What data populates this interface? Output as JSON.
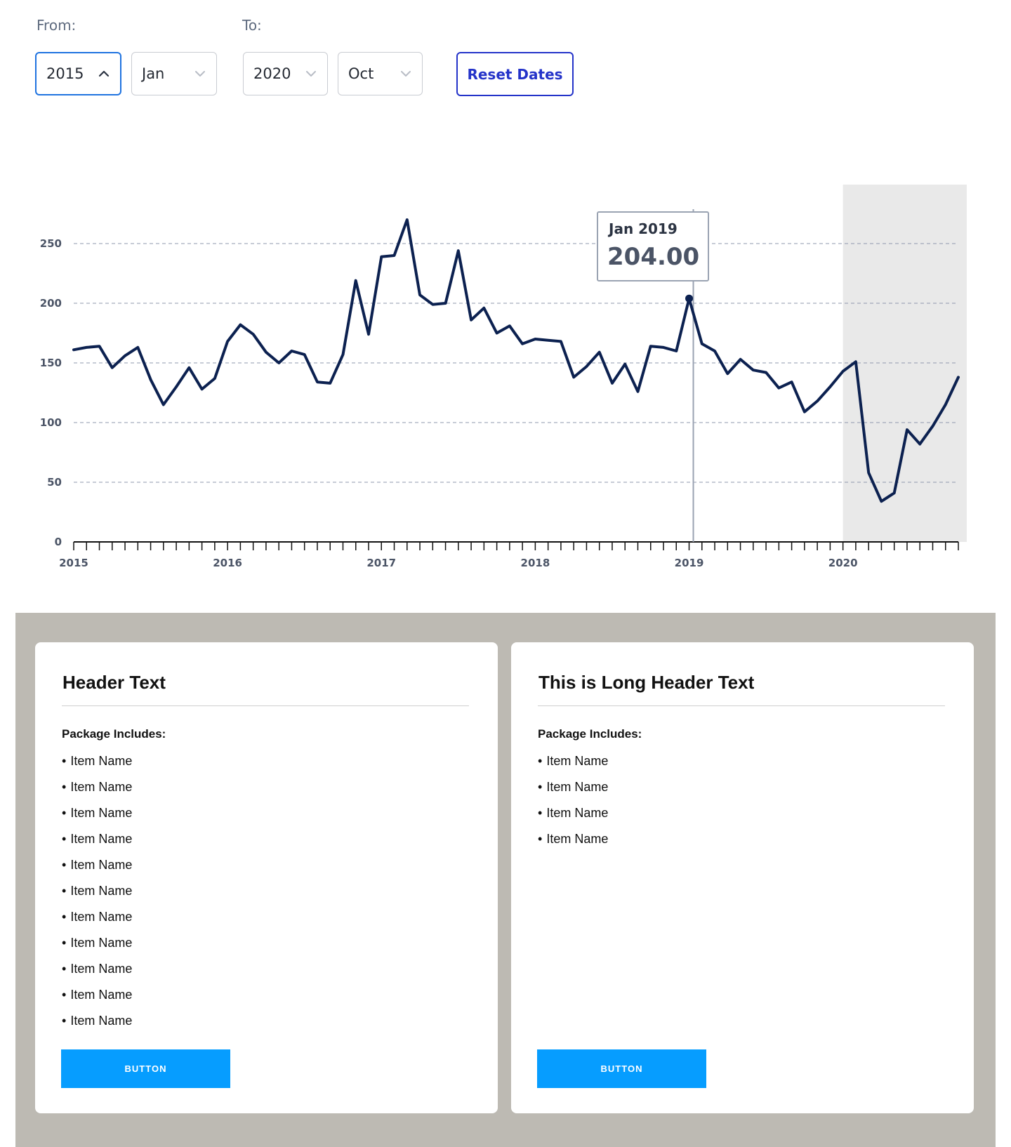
{
  "filters": {
    "from_label": "From:",
    "to_label": "To:",
    "from_year": "2015",
    "from_month": "Jan",
    "to_year": "2020",
    "to_month": "Oct",
    "reset_label": "Reset Dates"
  },
  "chart_data": {
    "type": "line",
    "title": "",
    "xlabel": "",
    "ylabel": "",
    "ylim": [
      0,
      250
    ],
    "yticks": [
      "0",
      "50",
      "100",
      "150",
      "200",
      "250"
    ],
    "xticks": [
      "2015",
      "2016",
      "2017",
      "2018",
      "2019",
      "2020"
    ],
    "grid": "horizontal-dashed",
    "x_start": "2015-01",
    "x_end": "2020-10",
    "shaded_range": [
      "2020-01",
      "2020-10"
    ],
    "series": [
      {
        "values": [
          161,
          163,
          164,
          146,
          156,
          163,
          136,
          115,
          130,
          146,
          128,
          137,
          168,
          182,
          174,
          159,
          150,
          160,
          157,
          134,
          133,
          157,
          219,
          174,
          239,
          240,
          270,
          207,
          199,
          200,
          244,
          186,
          196,
          175,
          181,
          166,
          170,
          169,
          168,
          138,
          147,
          159,
          133,
          149,
          126,
          164,
          163,
          160,
          204,
          166,
          160,
          141,
          153,
          144,
          142,
          129,
          134,
          109,
          118,
          130,
          143,
          151,
          58,
          34,
          41,
          94,
          82,
          97,
          115,
          138
        ],
        "color": "#0c2150"
      }
    ],
    "tooltip": {
      "date": "Jan 2019",
      "value": "204.00"
    },
    "colors": {
      "line": "#0c2150",
      "shade": "#e9e9e9",
      "grid": "#8f98ad",
      "cursor": "#9aa3b2"
    }
  },
  "cards": [
    {
      "title": "Header Text",
      "package_label": "Package Includes:",
      "items": [
        "Item Name",
        "Item Name",
        "Item Name",
        "Item Name",
        "Item Name",
        "Item Name",
        "Item Name",
        "Item Name",
        "Item Name",
        "Item Name",
        "Item Name"
      ],
      "button_label": "BUTTON"
    },
    {
      "title": "This is Long Header Text",
      "package_label": "Package Includes:",
      "items": [
        "Item Name",
        "Item Name",
        "Item Name",
        "Item Name"
      ],
      "button_label": "BUTTON"
    }
  ],
  "colors": {
    "accent": "#2433c9",
    "focus": "#1f73e0",
    "button": "#069dff",
    "section_bg": "#bdbab3"
  }
}
